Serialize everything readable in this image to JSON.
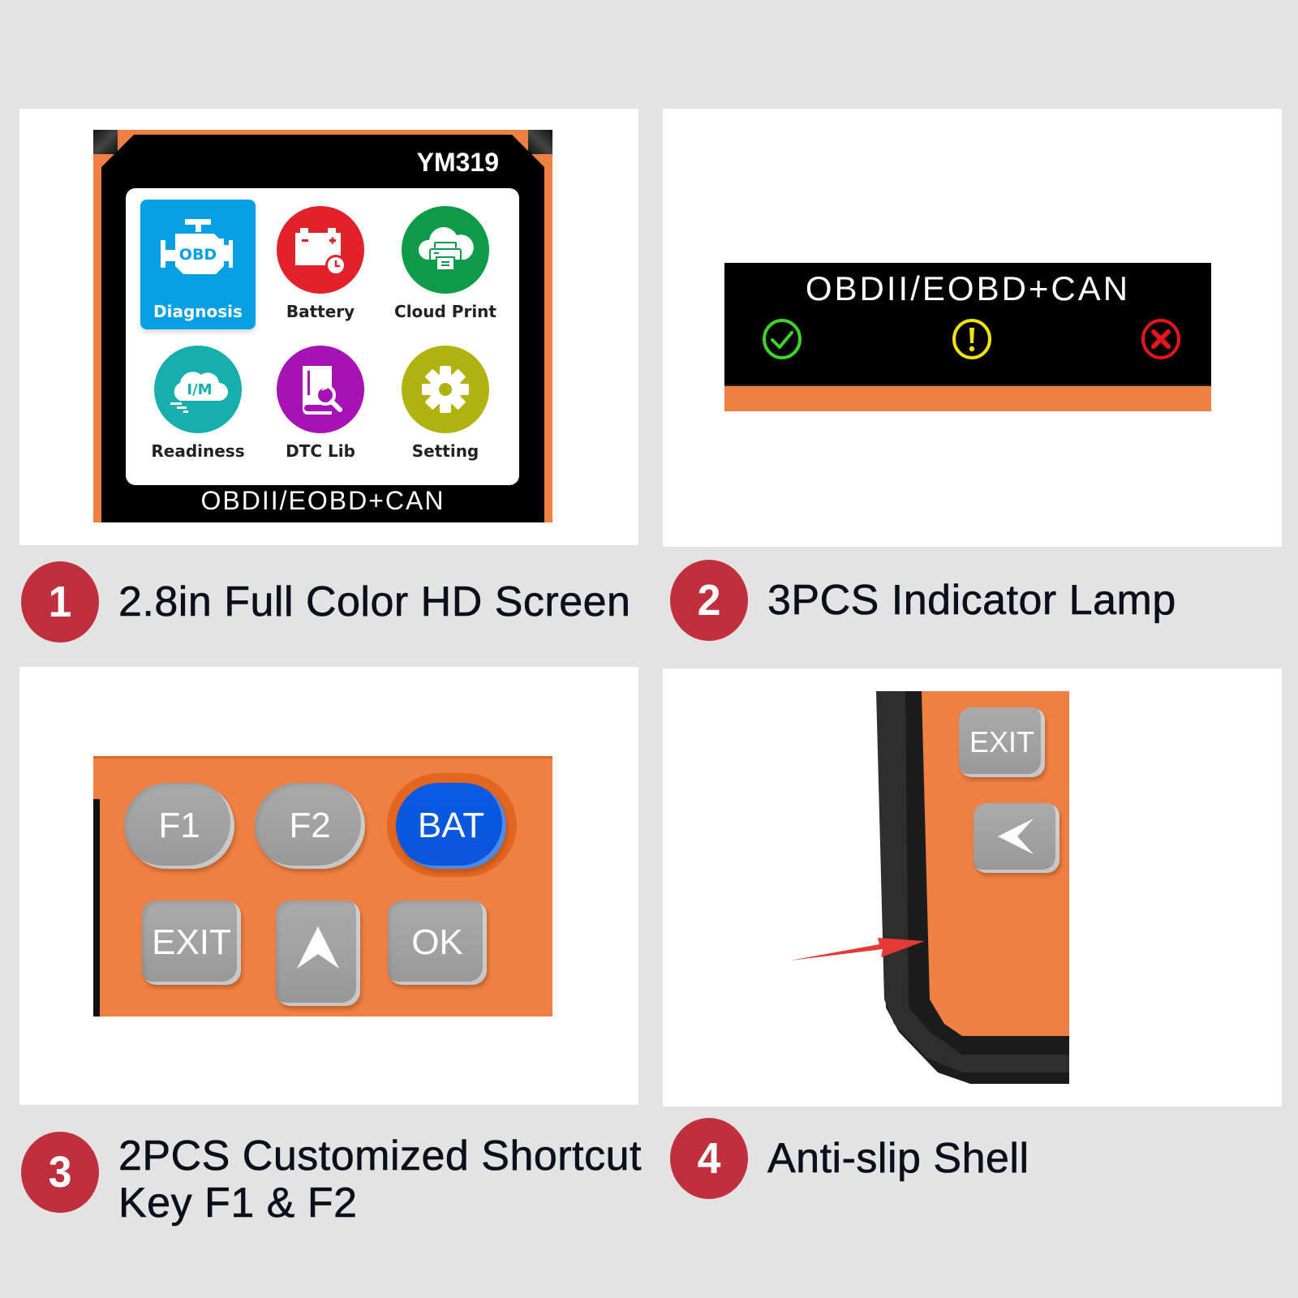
{
  "colors": {
    "background": "#e3e3e3",
    "card": "#ffffff",
    "badge": "#bf2f3c",
    "device_orange": "#ee8043",
    "selected_tile": "#04a0e3",
    "lamp_ok": "#3ed22a",
    "lamp_warn": "#f0e300",
    "lamp_error": "#e5161b",
    "arrow": "#e53935"
  },
  "features": [
    {
      "number": "1",
      "title": "2.8in Full Color HD Screen"
    },
    {
      "number": "2",
      "title": "3PCS Indicator Lamp"
    },
    {
      "number": "3",
      "title_line1": "2PCS Customized Shortcut",
      "title_line2": "Key F1 & F2"
    },
    {
      "number": "4",
      "title": "Anti-slip Shell"
    }
  ],
  "screen": {
    "model": "YM319",
    "protocol": "OBDII/EOBD+CAN",
    "apps": [
      {
        "label": "Diagnosis",
        "icon": "obd-engine-icon",
        "color": "#04a0e3",
        "selected": true,
        "icon_text": "OBD"
      },
      {
        "label": "Battery",
        "icon": "battery-clock-icon",
        "color": "#e3212b",
        "selected": false
      },
      {
        "label": "Cloud Print",
        "icon": "cloud-printer-icon",
        "color": "#0e9a48",
        "selected": false
      },
      {
        "label": "Readiness",
        "icon": "im-cloud-icon",
        "color": "#17afae",
        "selected": false,
        "icon_text": "I/M"
      },
      {
        "label": "DTC Lib",
        "icon": "book-search-icon",
        "color": "#a712b4",
        "selected": false
      },
      {
        "label": "Setting",
        "icon": "gear-icon",
        "color": "#b0b20f",
        "selected": false
      }
    ]
  },
  "indicator": {
    "protocol": "OBDII/EOBD+CAN",
    "lamps": [
      {
        "name": "ok",
        "icon": "check-circle-icon"
      },
      {
        "name": "warning",
        "icon": "exclamation-circle-icon"
      },
      {
        "name": "error",
        "icon": "x-circle-icon"
      }
    ]
  },
  "keypad": {
    "keys": [
      "F1",
      "F2",
      "BAT",
      "EXIT",
      "OK"
    ],
    "up_key_icon": "chevron-up-icon"
  },
  "shell": {
    "exit_label": "EXIT",
    "left_key_icon": "chevron-left-icon"
  }
}
